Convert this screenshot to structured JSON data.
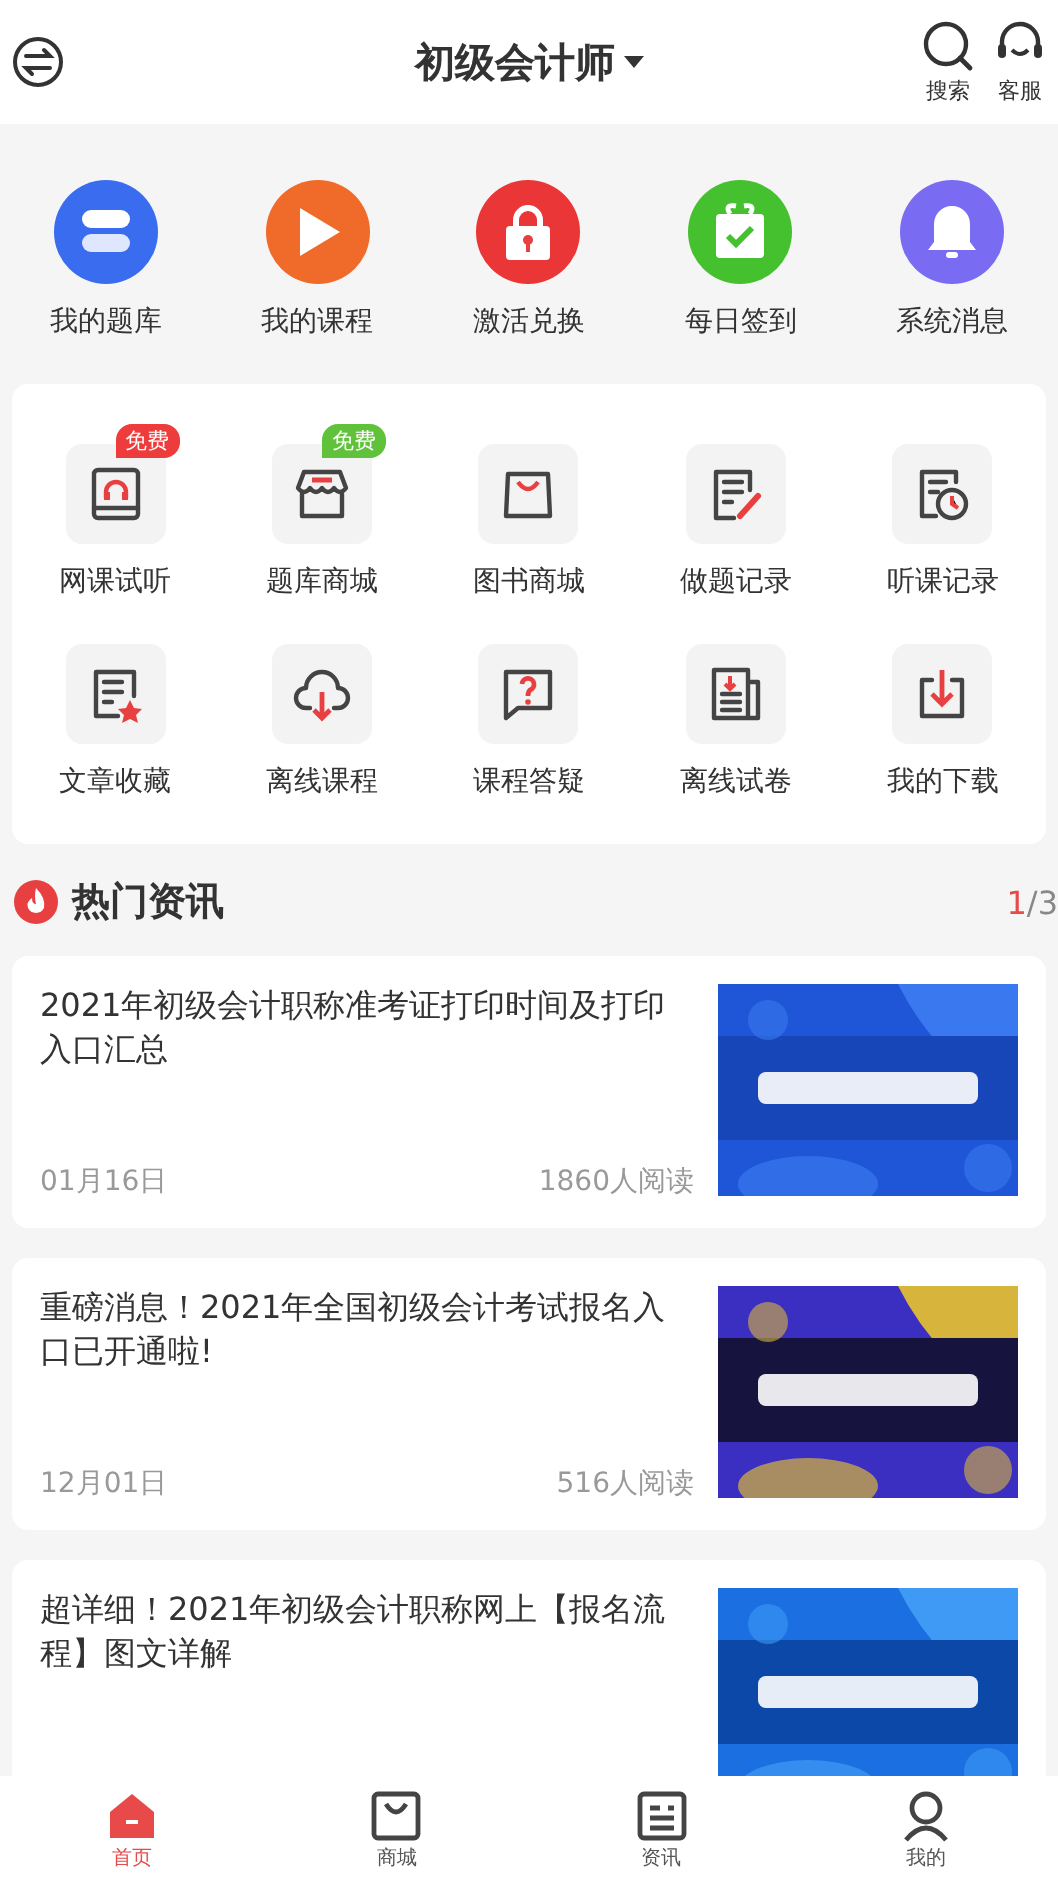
{
  "header": {
    "title": "初级会计师",
    "actions": [
      {
        "kind": "search",
        "label": "搜索"
      },
      {
        "kind": "service",
        "label": "客服"
      }
    ]
  },
  "quick_links": [
    {
      "kind": "book",
      "label": "我的题库",
      "color": "#3a6cf0"
    },
    {
      "kind": "play",
      "label": "我的课程",
      "color": "#f06a2a"
    },
    {
      "kind": "lock",
      "label": "激活兑换",
      "color": "#ea3636"
    },
    {
      "kind": "gift",
      "label": "每日签到",
      "color": "#45c02e"
    },
    {
      "kind": "bell",
      "label": "系统消息",
      "color": "#7a6cf2"
    }
  ],
  "tools": [
    {
      "kind": "audio-book",
      "label": "网课试听",
      "badge": {
        "text": "免费",
        "color": "#ee3b3b"
      }
    },
    {
      "kind": "store",
      "label": "题库商城",
      "badge": {
        "text": "免费",
        "color": "#5fc23a"
      }
    },
    {
      "kind": "bag",
      "label": "图书商城"
    },
    {
      "kind": "edit",
      "label": "做题记录"
    },
    {
      "kind": "history",
      "label": "听课记录"
    },
    {
      "kind": "star-doc",
      "label": "文章收藏"
    },
    {
      "kind": "cloud",
      "label": "离线课程"
    },
    {
      "kind": "question",
      "label": "课程答疑"
    },
    {
      "kind": "paper",
      "label": "离线试卷"
    },
    {
      "kind": "download",
      "label": "我的下载"
    }
  ],
  "news": {
    "title": "热门资讯",
    "page": "1",
    "total": "/3",
    "items": [
      {
        "title": "2021年初级会计职称准考证打印时间及打印入口汇总",
        "date": "01月16日",
        "reads": "1860人阅读"
      },
      {
        "title": "重磅消息！2021年全国初级会计考试报名入口已开通啦!",
        "date": "12月01日",
        "reads": "516人阅读"
      },
      {
        "title": "超详细！2021年初级会计职称网上【报名流程】图文详解"
      }
    ]
  },
  "tab_bar": [
    {
      "kind": "home",
      "label": "首页",
      "selected": true
    },
    {
      "kind": "bag",
      "label": "商城",
      "selected": false
    },
    {
      "kind": "news",
      "label": "资讯",
      "selected": false
    },
    {
      "kind": "user",
      "label": "我的",
      "selected": false
    }
  ]
}
